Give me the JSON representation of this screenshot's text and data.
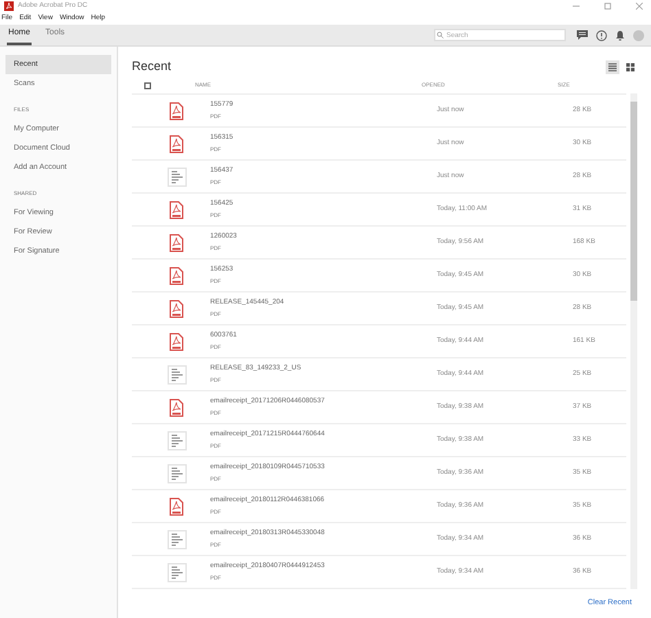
{
  "window": {
    "title": "Adobe Acrobat Pro DC"
  },
  "menu": [
    "File",
    "Edit",
    "View",
    "Window",
    "Help"
  ],
  "tabs": [
    {
      "label": "Home",
      "selected": true
    },
    {
      "label": "Tools",
      "selected": false
    }
  ],
  "search": {
    "placeholder": "Search"
  },
  "sidebar": {
    "items": [
      {
        "kind": "item",
        "label": "Recent",
        "selected": true
      },
      {
        "kind": "item",
        "label": "Scans",
        "selected": false
      },
      {
        "kind": "header",
        "label": "FILES"
      },
      {
        "kind": "item",
        "label": "My Computer",
        "selected": false
      },
      {
        "kind": "item",
        "label": "Document Cloud",
        "selected": false
      },
      {
        "kind": "item",
        "label": "Add an Account",
        "selected": false
      },
      {
        "kind": "header",
        "label": "SHARED"
      },
      {
        "kind": "item",
        "label": "For Viewing",
        "selected": false
      },
      {
        "kind": "item",
        "label": "For Review",
        "selected": false
      },
      {
        "kind": "item",
        "label": "For Signature",
        "selected": false
      }
    ]
  },
  "main": {
    "title": "Recent",
    "view_buttons": [
      {
        "kind": "list",
        "selected": true
      },
      {
        "kind": "grid",
        "selected": false
      }
    ],
    "select_all": {
      "checked": false
    },
    "columns": [
      "NAME",
      "OPENED",
      "SIZE"
    ],
    "rows": [
      {
        "kind": "pdf",
        "name": "155779",
        "type": "PDF",
        "opened": "Just now",
        "size": "28 KB"
      },
      {
        "kind": "pdf",
        "name": "156315",
        "type": "PDF",
        "opened": "Just now",
        "size": "30 KB"
      },
      {
        "kind": "thumbnail",
        "name": "156437",
        "type": "PDF",
        "opened": "Just now",
        "size": "28 KB"
      },
      {
        "kind": "pdf",
        "name": "156425",
        "type": "PDF",
        "opened": "Today, 11:00 AM",
        "size": "31 KB"
      },
      {
        "kind": "pdf",
        "name": "1260023",
        "type": "PDF",
        "opened": "Today, 9:56 AM",
        "size": "168 KB"
      },
      {
        "kind": "pdf",
        "name": "156253",
        "type": "PDF",
        "opened": "Today, 9:45 AM",
        "size": "30 KB"
      },
      {
        "kind": "pdf",
        "name": "RELEASE_145445_204",
        "type": "PDF",
        "opened": "Today, 9:45 AM",
        "size": "28 KB"
      },
      {
        "kind": "pdf",
        "name": "6003761",
        "type": "PDF",
        "opened": "Today, 9:44 AM",
        "size": "161 KB"
      },
      {
        "kind": "thumbnail",
        "name": "RELEASE_83_149233_2_US",
        "type": "PDF",
        "opened": "Today, 9:44 AM",
        "size": "25 KB"
      },
      {
        "kind": "pdf",
        "name": "emailreceipt_20171206R0446080537",
        "type": "PDF",
        "opened": "Today, 9:38 AM",
        "size": "37 KB"
      },
      {
        "kind": "thumbnail",
        "name": "emailreceipt_20171215R0444760644",
        "type": "PDF",
        "opened": "Today, 9:38 AM",
        "size": "33 KB"
      },
      {
        "kind": "thumbnail",
        "name": "emailreceipt_20180109R0445710533",
        "type": "PDF",
        "opened": "Today, 9:36 AM",
        "size": "35 KB"
      },
      {
        "kind": "pdf",
        "name": "emailreceipt_20180112R0446381066",
        "type": "PDF",
        "opened": "Today, 9:36 AM",
        "size": "35 KB"
      },
      {
        "kind": "thumbnail",
        "name": "emailreceipt_20180313R0445330048",
        "type": "PDF",
        "opened": "Today, 9:34 AM",
        "size": "36 KB"
      },
      {
        "kind": "thumbnail",
        "name": "emailreceipt_20180407R0444912453",
        "type": "PDF",
        "opened": "Today, 9:34 AM",
        "size": "36 KB"
      }
    ],
    "clear_link": "Clear Recent"
  }
}
